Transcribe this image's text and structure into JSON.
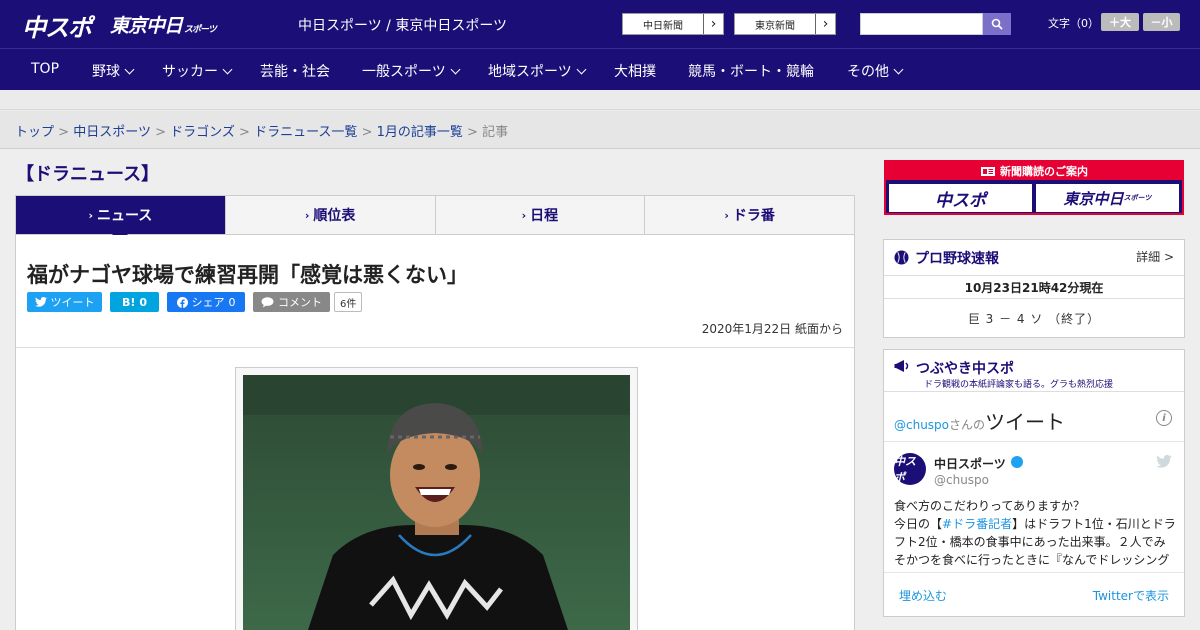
{
  "header": {
    "logo_chuspo": "中スポ",
    "logo_tokyo": "東京中日",
    "logo_tokyo_sub": "スポーツ",
    "site_names": "中日スポーツ / 東京中日スポーツ",
    "paper_links": [
      "中日新聞",
      "東京新聞"
    ],
    "search_placeholder": "",
    "font_size_label": "文字（0）",
    "font_larger": "＋大",
    "font_smaller": "－小"
  },
  "nav": {
    "items": [
      {
        "label": "TOP"
      },
      {
        "label": "野球"
      },
      {
        "label": "サッカー"
      },
      {
        "label": "芸能・社会"
      },
      {
        "label": "一般スポーツ"
      },
      {
        "label": "地域スポーツ"
      },
      {
        "label": "大相撲"
      },
      {
        "label": "競馬・ボート・競輪"
      },
      {
        "label": "その他"
      }
    ]
  },
  "breadcrumb": {
    "items": [
      "トップ",
      "中日スポーツ",
      "ドラゴンズ",
      "ドラニュース一覧",
      "1月の記事一覧"
    ],
    "separator": ">",
    "current": "記事"
  },
  "section_title": "【ドラニュース】",
  "tabs": [
    "ニュース",
    "順位表",
    "日程",
    "ドラ番"
  ],
  "article": {
    "headline": "福がナゴヤ球場で練習再開「感覚は悪くない」",
    "tweet_label": "ツイート",
    "hatena_label": "B!",
    "hatena_count": "0",
    "share_label": "シェア",
    "share_count": "0",
    "comment_label": "コメント",
    "comment_count": "6件",
    "date": "2020年1月22日 紙面から"
  },
  "sidebar": {
    "promo_title": "新聞購読のご案内",
    "promo_chuspo": "中スポ",
    "promo_tokyo": "東京中日",
    "promo_tokyo_sub": "スポーツ",
    "baseball": {
      "title": "プロ野球速報",
      "detail": "詳細 >",
      "time": "10月23日21時42分現在",
      "score": "巨 3 － 4 ソ （終了）"
    },
    "tsubuyaki": {
      "title": "つぶやき中スポ",
      "subtitle": "ドラ観戦の本紙評論家も語る。グラも熱烈応援",
      "handle": "@chuspo",
      "handle_suffix": "さんの",
      "tweet_word": "ツイート",
      "account_name": "中日スポーツ",
      "screen_name": "@chuspo",
      "avatar_text": "中スポ",
      "tweet_line1": "食べ方のこだわりってありますか？",
      "tweet_line2_pre": "今日の【",
      "tweet_hashtag": "#ドラ番記者",
      "tweet_line2_post": "】はドラフト1位・石川とドラフト2位・橋本の食事中にあった出来事。２人でみそかつを食べに行ったときに『なんでドレッシング",
      "embed": "埋め込む",
      "view": "Twitterで表示"
    }
  },
  "colors": {
    "brand": "#1c0e77",
    "accent_red": "#e60033",
    "twitter": "#1da1f2",
    "facebook": "#1877f2",
    "hatena": "#00a4de"
  }
}
